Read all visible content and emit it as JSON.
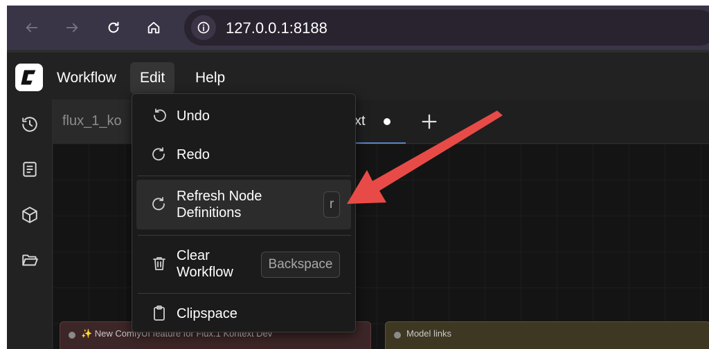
{
  "browser": {
    "url": "127.0.0.1:8188",
    "icons": [
      "back-arrow-icon",
      "forward-arrow-icon",
      "reload-icon",
      "home-icon",
      "site-info-icon"
    ]
  },
  "menubar": {
    "logo_icon": "comfy-logo-icon",
    "items": [
      {
        "label": "Workflow"
      },
      {
        "label": "Edit"
      },
      {
        "label": "Help"
      }
    ]
  },
  "sidebar": {
    "icons": [
      "history-icon",
      "book-icon",
      "cube-icon",
      "folder-open-icon"
    ]
  },
  "tabs": {
    "items": [
      {
        "label": "flux_1_ko"
      },
      {
        "label": "xt"
      }
    ],
    "add_tab_icon": "plus-icon"
  },
  "edit_menu": {
    "undo": {
      "label": "Undo",
      "icon": "undo-icon"
    },
    "redo": {
      "label": "Redo",
      "icon": "redo-icon"
    },
    "refresh": {
      "label_line1": "Refresh Node",
      "label_line2": "Definitions",
      "shortcut": "r",
      "icon": "refresh-icon"
    },
    "clear": {
      "label_line1": "Clear",
      "label_line2": "Workflow",
      "shortcut": "Backspace",
      "icon": "trash-icon"
    },
    "clipspace": {
      "label": "Clipspace",
      "icon": "clipboard-icon"
    }
  },
  "canvas": {
    "groups": [
      {
        "title": "✨ New ComfyUI feature for Flux.1 Kontext Dev",
        "color": "#3d2627"
      },
      {
        "title": "Model links",
        "color": "#3e3823"
      }
    ]
  },
  "annotation": {
    "color": "#e84b47"
  }
}
